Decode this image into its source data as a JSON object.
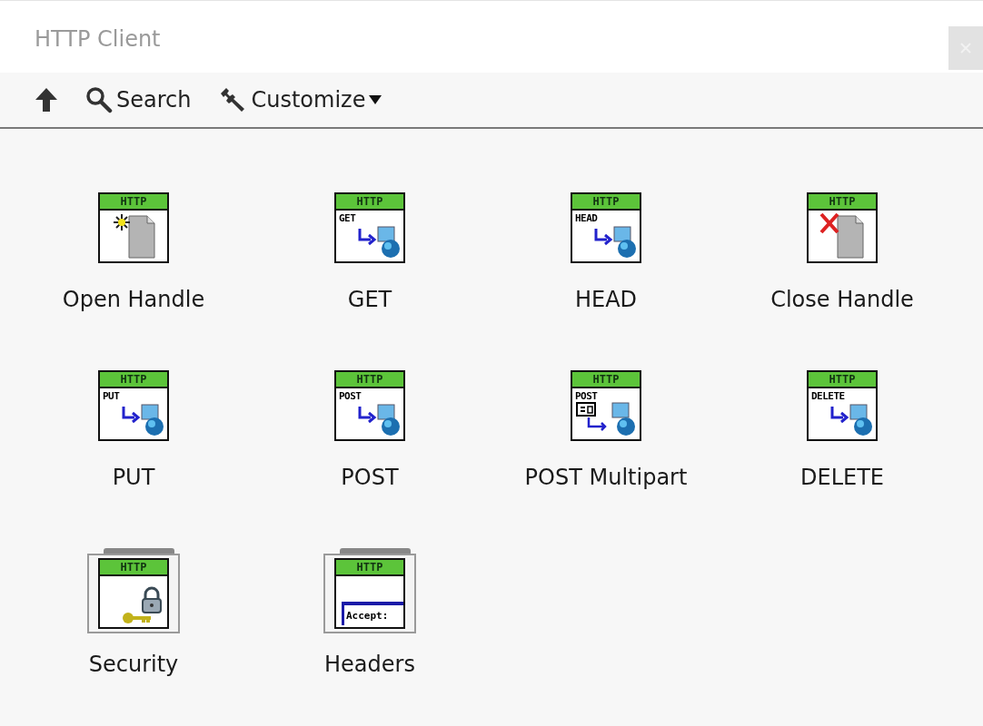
{
  "window": {
    "title": "HTTP Client"
  },
  "toolbar": [
    {
      "kind": "up"
    },
    {
      "kind": "search",
      "label": "Search"
    },
    {
      "kind": "customize",
      "label": "Customize"
    }
  ],
  "palette": [
    {
      "label": "Open Handle",
      "kind": "open",
      "badge": "HTTP"
    },
    {
      "label": "GET",
      "kind": "request",
      "badge": "HTTP",
      "verb": "GET"
    },
    {
      "label": "HEAD",
      "kind": "request",
      "badge": "HTTP",
      "verb": "HEAD"
    },
    {
      "label": "Close Handle",
      "kind": "close",
      "badge": "HTTP"
    },
    {
      "label": "PUT",
      "kind": "request",
      "badge": "HTTP",
      "verb": "PUT"
    },
    {
      "label": "POST",
      "kind": "request",
      "badge": "HTTP",
      "verb": "POST"
    },
    {
      "label": "POST Multipart",
      "kind": "multipart",
      "badge": "HTTP",
      "verb": "POST"
    },
    {
      "label": "DELETE",
      "kind": "request",
      "badge": "HTTP",
      "verb": "DELETE"
    },
    {
      "label": "Security",
      "kind": "security",
      "badge": "HTTP"
    },
    {
      "label": "Headers",
      "kind": "headers",
      "badge": "HTTP",
      "verb": "Accept:"
    }
  ]
}
